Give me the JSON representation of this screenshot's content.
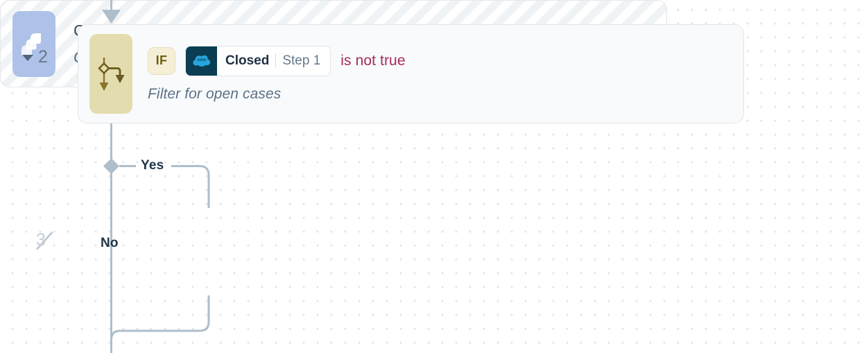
{
  "canvas": {
    "grid": "dot-grid",
    "background_color": "#ffffff",
    "dot_color": "#e4e6e8"
  },
  "steps": [
    {
      "index_label": "2",
      "collapsed": false,
      "disabled": false,
      "type": "condition",
      "glyph_icon": "branch-icon",
      "glyph_bg": "#e3dcae",
      "condition": {
        "operator_badge": "IF",
        "field_logo": "salesforce-icon",
        "field_logo_bg": "#0b3e53",
        "field_name": "Closed",
        "field_source": "Step 1",
        "comparison": "is not true",
        "comparison_color": "#a62a5e"
      },
      "subtitle": "Filter for open cases",
      "branches": [
        {
          "label": "Yes"
        },
        {
          "label": "No"
        }
      ]
    },
    {
      "index_label": "3",
      "disabled": true,
      "type": "action",
      "glyph_icon": "jira-icon",
      "glyph_bg": "#aec1e8",
      "title": "Create issue in Jira",
      "subtitle": "Create a new issue in Jira with the case details",
      "placeholder_style": "diagonal-stripes"
    }
  ]
}
